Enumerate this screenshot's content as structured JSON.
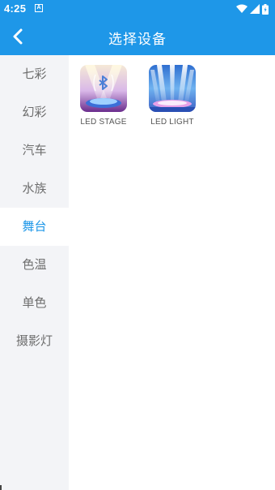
{
  "status": {
    "time": "4:25",
    "sim_glyph": "A",
    "icons": [
      "wifi-icon",
      "signal-icon",
      "battery-icon"
    ]
  },
  "header": {
    "title": "选择设备",
    "back_icon": "chevron-left-icon"
  },
  "sidebar": {
    "items": [
      {
        "label": "七彩"
      },
      {
        "label": "幻彩"
      },
      {
        "label": "汽车"
      },
      {
        "label": "水族"
      },
      {
        "label": "舞台"
      },
      {
        "label": "色温"
      },
      {
        "label": "单色"
      },
      {
        "label": "摄影灯"
      }
    ],
    "active_index": 4
  },
  "devices": [
    {
      "label": "LED STAGE",
      "icon": "stage-bluetooth-icon"
    },
    {
      "label": "LED LIGHT",
      "icon": "stage-spotlights-icon"
    }
  ],
  "colors": {
    "accent": "#1e97e8",
    "sidebar_bg": "#f3f4f7",
    "inactive_text": "#6e6e6e"
  }
}
